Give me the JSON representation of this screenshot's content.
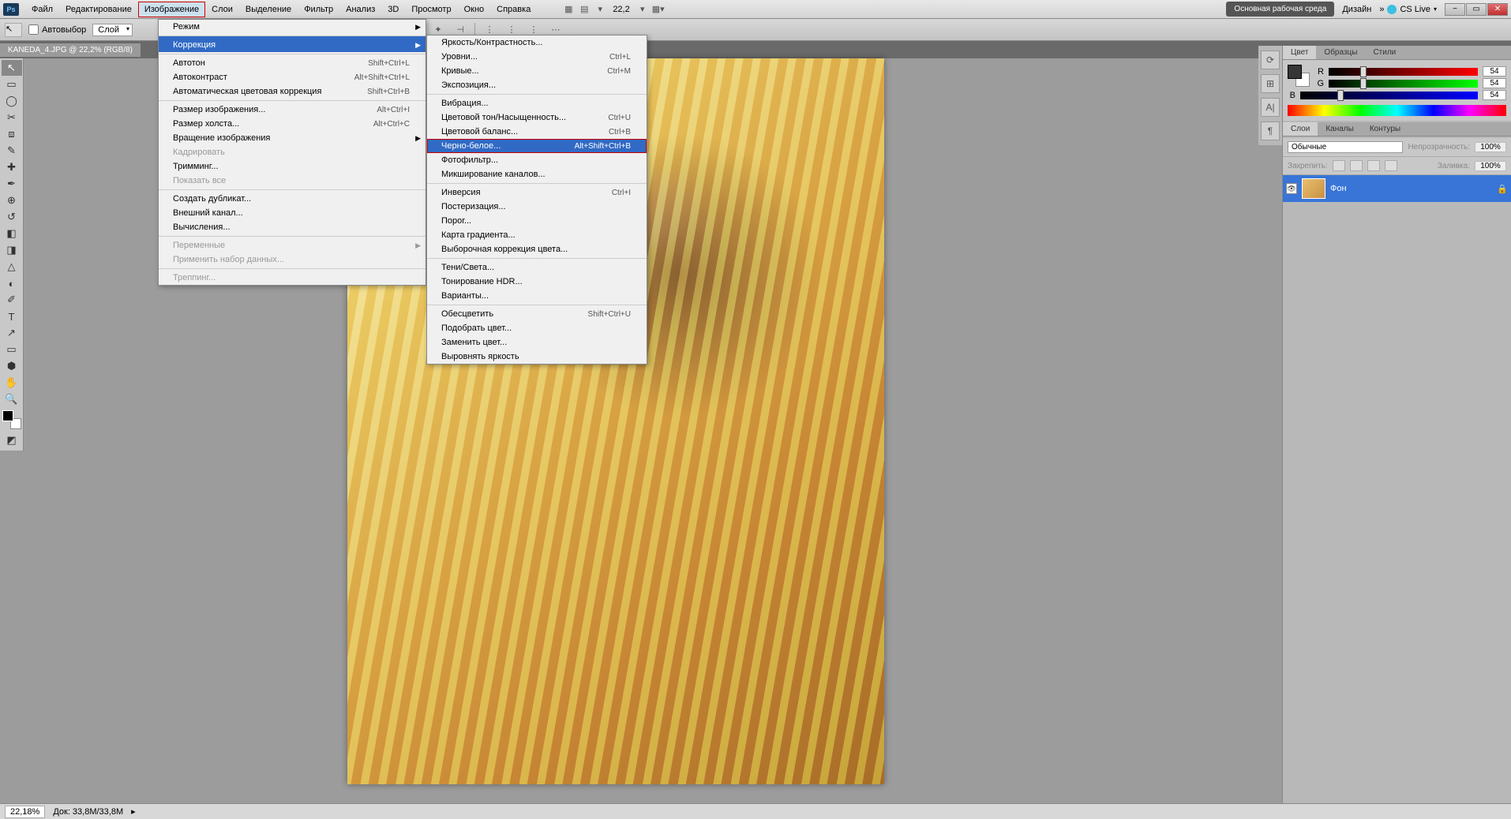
{
  "menubar": {
    "items": [
      "Файл",
      "Редактирование",
      "Изображение",
      "Слои",
      "Выделение",
      "Фильтр",
      "Анализ",
      "3D",
      "Просмотр",
      "Окно",
      "Справка"
    ],
    "active_index": 2,
    "zoom": "22,2",
    "workspace_primary": "Основная рабочая среда",
    "workspace_secondary": "Дизайн",
    "cslive": "CS Live"
  },
  "optbar": {
    "autoselect": "Автовыбор",
    "layer_drop": "Слой"
  },
  "doc_tab": "KANEDA_4.JPG @ 22,2% (RGB/8)",
  "menu_image": {
    "items": [
      {
        "label": "Режим",
        "arrow": true
      },
      {
        "label": "Коррекция",
        "arrow": true,
        "hl": true,
        "sep": true
      },
      {
        "label": "Автотон",
        "shortcut": "Shift+Ctrl+L",
        "sep": true
      },
      {
        "label": "Автоконтраст",
        "shortcut": "Alt+Shift+Ctrl+L"
      },
      {
        "label": "Автоматическая цветовая коррекция",
        "shortcut": "Shift+Ctrl+B"
      },
      {
        "label": "Размер изображения...",
        "shortcut": "Alt+Ctrl+I",
        "sep": true
      },
      {
        "label": "Размер холста...",
        "shortcut": "Alt+Ctrl+C"
      },
      {
        "label": "Вращение изображения",
        "arrow": true
      },
      {
        "label": "Кадрировать",
        "dis": true
      },
      {
        "label": "Тримминг..."
      },
      {
        "label": "Показать все",
        "dis": true
      },
      {
        "label": "Создать дубликат...",
        "sep": true
      },
      {
        "label": "Внешний канал..."
      },
      {
        "label": "Вычисления..."
      },
      {
        "label": "Переменные",
        "arrow": true,
        "dis": true,
        "sep": true
      },
      {
        "label": "Применить набор данных...",
        "dis": true
      },
      {
        "label": "Треппинг...",
        "dis": true,
        "sep": true
      }
    ]
  },
  "menu_correction": {
    "items": [
      {
        "label": "Яркость/Контрастность..."
      },
      {
        "label": "Уровни...",
        "shortcut": "Ctrl+L"
      },
      {
        "label": "Кривые...",
        "shortcut": "Ctrl+M"
      },
      {
        "label": "Экспозиция..."
      },
      {
        "label": "Вибрация...",
        "sep": true
      },
      {
        "label": "Цветовой тон/Насыщенность...",
        "shortcut": "Ctrl+U"
      },
      {
        "label": "Цветовой баланс...",
        "shortcut": "Ctrl+B"
      },
      {
        "label": "Черно-белое...",
        "shortcut": "Alt+Shift+Ctrl+B",
        "hl": true
      },
      {
        "label": "Фотофильтр..."
      },
      {
        "label": "Микширование каналов..."
      },
      {
        "label": "Инверсия",
        "shortcut": "Ctrl+I",
        "sep": true
      },
      {
        "label": "Постеризация..."
      },
      {
        "label": "Порог..."
      },
      {
        "label": "Карта градиента..."
      },
      {
        "label": "Выборочная коррекция цвета..."
      },
      {
        "label": "Тени/Света...",
        "sep": true
      },
      {
        "label": "Тонирование HDR..."
      },
      {
        "label": "Варианты..."
      },
      {
        "label": "Обесцветить",
        "shortcut": "Shift+Ctrl+U",
        "sep": true
      },
      {
        "label": "Подобрать цвет..."
      },
      {
        "label": "Заменить цвет..."
      },
      {
        "label": "Выровнять яркость"
      }
    ]
  },
  "color_panel": {
    "tabs": [
      "Цвет",
      "Образцы",
      "Стили"
    ],
    "r": {
      "label": "R",
      "value": "54"
    },
    "g": {
      "label": "G",
      "value": "54"
    },
    "b": {
      "label": "B",
      "value": "54"
    }
  },
  "layers_panel": {
    "tabs": [
      "Слои",
      "Каналы",
      "Контуры"
    ],
    "mode": "Обычные",
    "opacity_label": "Непрозрачность:",
    "opacity": "100%",
    "lock_label": "Закрепить:",
    "fill_label": "Заливка:",
    "fill": "100%",
    "layer_name": "Фон"
  },
  "status": {
    "zoom": "22,18%",
    "doc": "Док: 33,8M/33,8M"
  },
  "tools": [
    "↖",
    "▭",
    "◯",
    "✂",
    "✎",
    "✒",
    "⌒",
    "✐",
    "⊕",
    "◧",
    "✦",
    "△",
    "⬚",
    "T",
    "↗",
    "⬡",
    "✋",
    "🔍",
    "◩"
  ]
}
